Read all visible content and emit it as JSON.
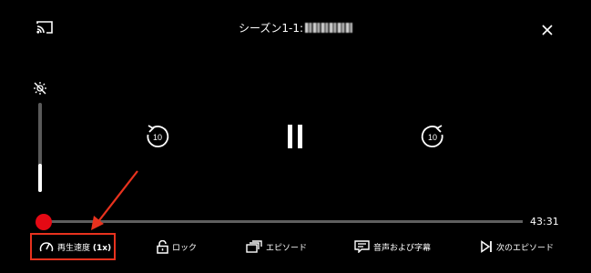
{
  "header": {
    "title_prefix": "シーズン1-1:"
  },
  "brightness": {
    "level": 0.32
  },
  "playback": {
    "skip_back_seconds": "10",
    "skip_forward_seconds": "10",
    "progress": 0.0,
    "remaining_time": "43:31"
  },
  "controls": {
    "speed_label": "再生速度 ",
    "speed_value": "(1x)",
    "lock_label": "ロック",
    "episodes_label": "エピソード",
    "audio_subtitles_label": "音声および字幕",
    "next_episode_label": "次のエピソード"
  },
  "colors": {
    "background": "#000000",
    "accent": "#e50914",
    "annotation": "#e8321e",
    "track": "#5e5e5e"
  },
  "icons": [
    "cast-icon",
    "close-icon",
    "brightness-icon",
    "replay-10-icon",
    "pause-icon",
    "forward-10-icon",
    "speedometer-icon",
    "lock-icon",
    "episodes-icon",
    "subtitles-icon",
    "next-episode-icon"
  ]
}
